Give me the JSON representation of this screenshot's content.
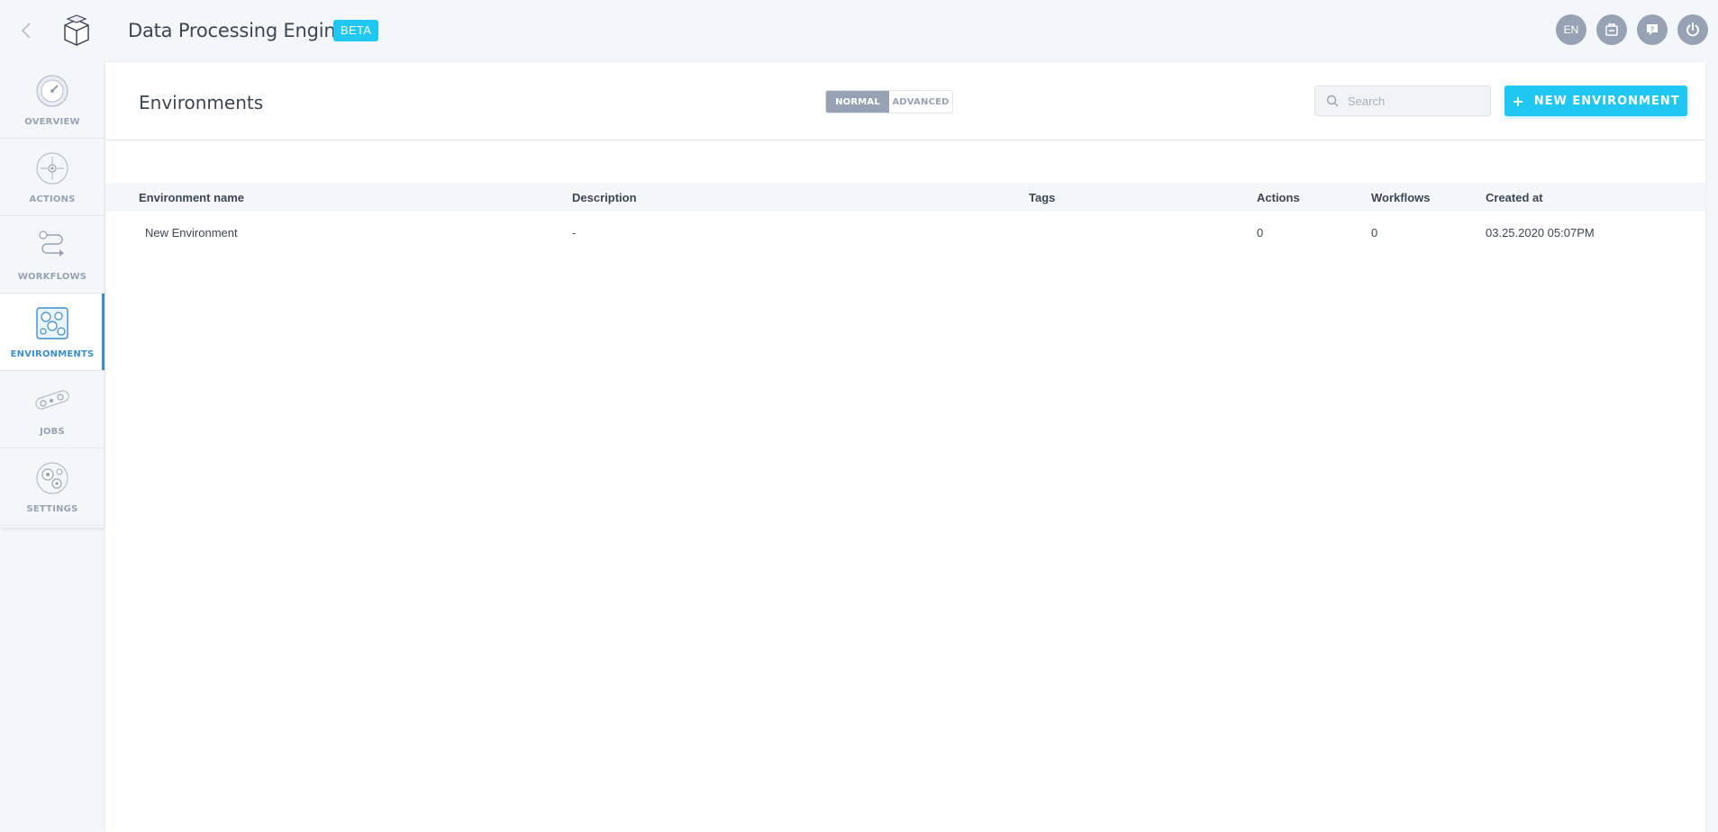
{
  "header": {
    "app_title": "Data Processing Engine",
    "badge": "BETA",
    "language": "EN",
    "icons": [
      "back-arrow-icon",
      "cube-logo-icon",
      "clipboard-icon",
      "help-icon",
      "power-icon"
    ]
  },
  "sidebar": {
    "items": [
      {
        "label": "OVERVIEW",
        "icon": "gauge-icon"
      },
      {
        "label": "ACTIONS",
        "icon": "target-icon"
      },
      {
        "label": "WORKFLOWS",
        "icon": "workflow-path-icon"
      },
      {
        "label": "ENVIRONMENTS",
        "icon": "environment-network-icon",
        "active": true
      },
      {
        "label": "JOBS",
        "icon": "conveyor-belt-icon"
      },
      {
        "label": "SETTINGS",
        "icon": "gears-icon"
      }
    ]
  },
  "main": {
    "title": "Environments",
    "toggle": {
      "normal": "NORMAL",
      "advanced": "ADVANCED",
      "selected": "NORMAL"
    },
    "search": {
      "placeholder": "Search",
      "value": ""
    },
    "new_button": {
      "plus": "+",
      "label": "NEW ENVIRONMENT"
    },
    "table": {
      "columns": [
        "Environment name",
        "Description",
        "Tags",
        "Actions",
        "Workflows",
        "Created at"
      ],
      "rows": [
        {
          "name": "New Environment",
          "description": "-",
          "tags": "",
          "actions": "0",
          "workflows": "0",
          "created_at": "03.25.2020 05:07PM"
        }
      ]
    }
  },
  "colors": {
    "accent": "#1fc7f2",
    "active_nav": "#3a8fcf",
    "muted": "#97a3b4",
    "background": "#f4f7fa"
  }
}
